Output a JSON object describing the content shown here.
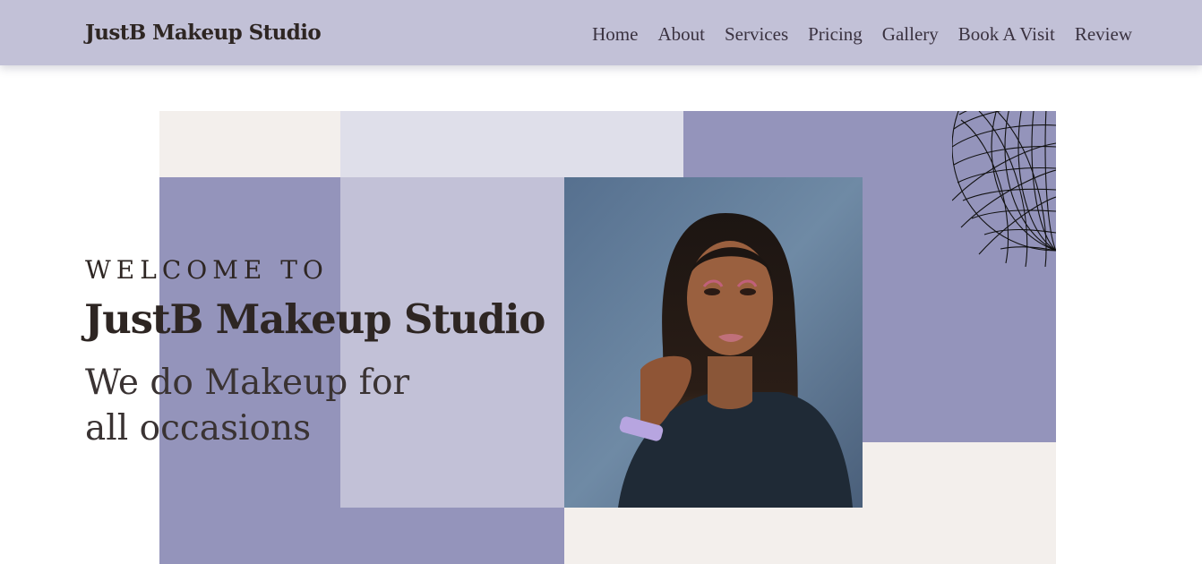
{
  "nav": {
    "brand": "JustB Makeup Studio",
    "links": [
      "Home",
      "About",
      "Services",
      "Pricing",
      "Gallery",
      "Book A Visit",
      "Review"
    ]
  },
  "hero": {
    "welcome": "WELCOME TO",
    "title": "JustB Makeup Studio",
    "tagline_line1": "We do Makeup for",
    "tagline_line2": "all occasions"
  },
  "colors": {
    "nav_bg": "#c2c1d7",
    "purple": "#9494bb",
    "lavender": "#c2c1d7",
    "pale_lavender": "#dfdfea",
    "cream": "#f3efec",
    "text": "#2e2623"
  }
}
